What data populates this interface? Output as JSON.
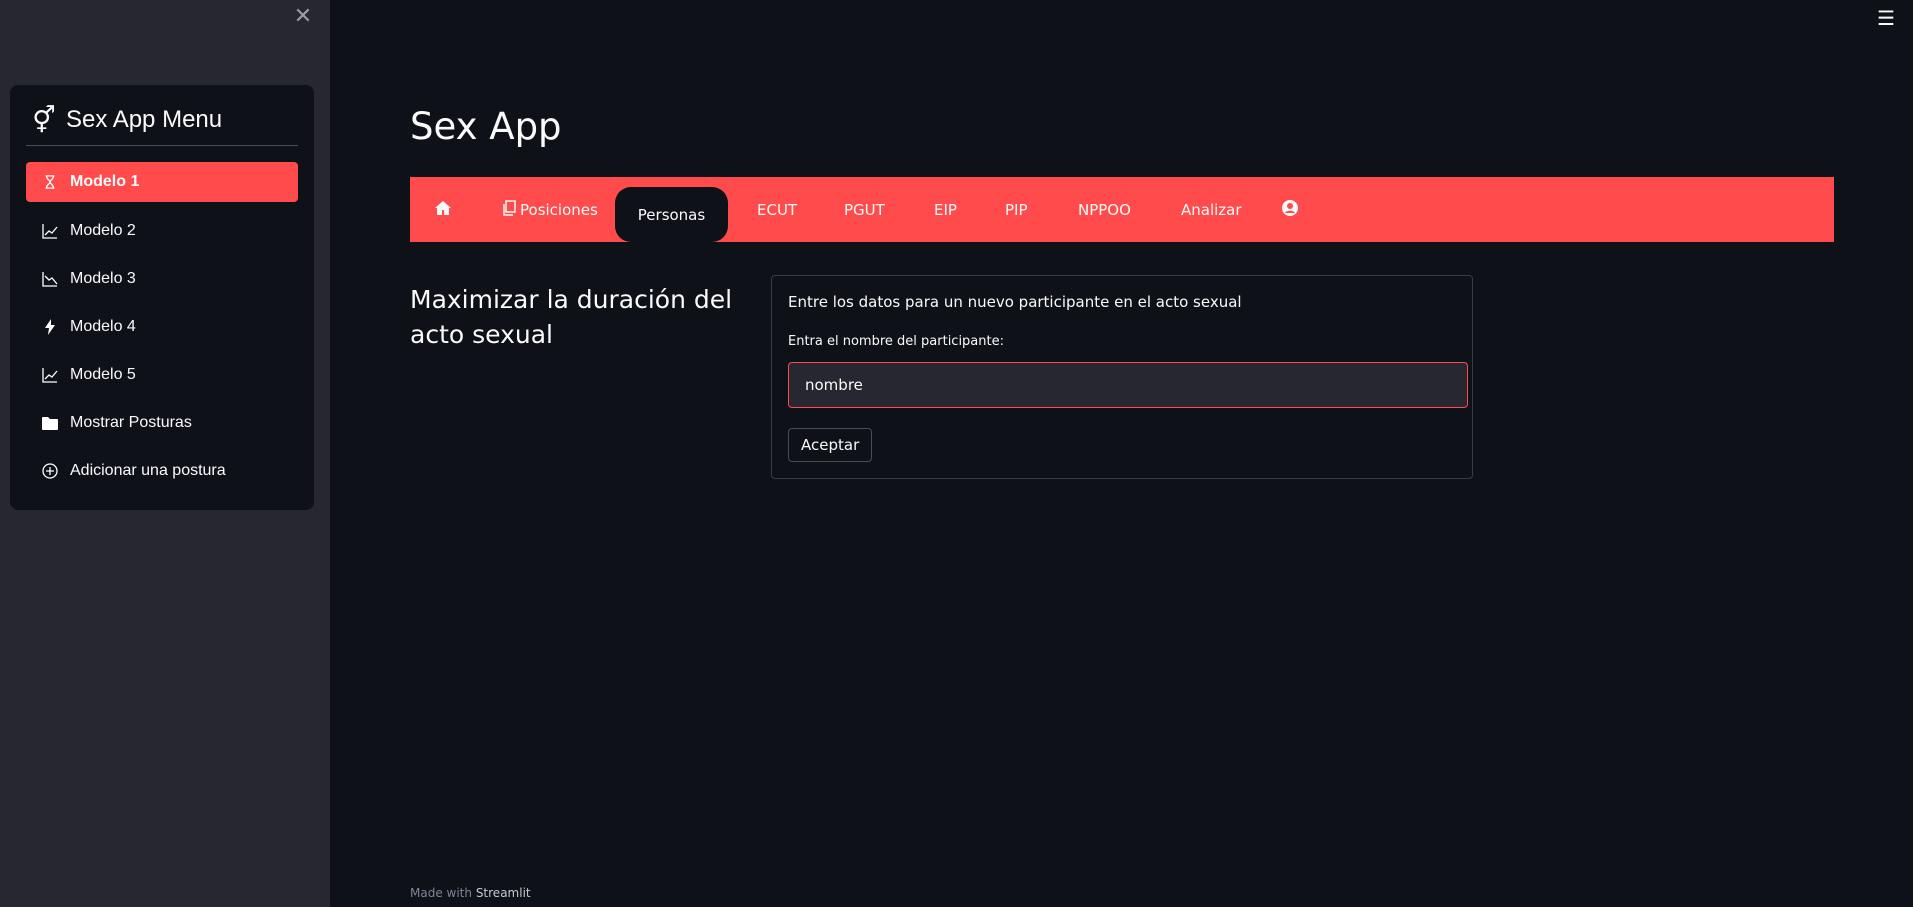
{
  "sidebar": {
    "title": "Sex App Menu",
    "items": [
      {
        "label": "Modelo 1",
        "icon": "hourglass-icon",
        "active": true
      },
      {
        "label": "Modelo 2",
        "icon": "graph-up-icon",
        "active": false
      },
      {
        "label": "Modelo 3",
        "icon": "graph-down-icon",
        "active": false
      },
      {
        "label": "Modelo 4",
        "icon": "lightning-icon",
        "active": false
      },
      {
        "label": "Modelo 5",
        "icon": "graph-up-icon",
        "active": false
      },
      {
        "label": "Mostrar Posturas",
        "icon": "folder-icon",
        "active": false
      },
      {
        "label": "Adicionar una postura",
        "icon": "plus-circle-icon",
        "active": false
      }
    ]
  },
  "main": {
    "title": "Sex App",
    "tabs": [
      {
        "label": "",
        "icon": "home-icon"
      },
      {
        "label": "Posiciones",
        "icon": "copy-icon"
      },
      {
        "label": "Personas",
        "active": true
      },
      {
        "label": "ECUT"
      },
      {
        "label": "PGUT"
      },
      {
        "label": "EIP"
      },
      {
        "label": "PIP"
      },
      {
        "label": "NPPOO"
      },
      {
        "label": "Analizar"
      },
      {
        "label": "",
        "icon": "user-circle-icon"
      }
    ],
    "section_heading": "Maximizar la duración del acto sexual",
    "form": {
      "description": "Entre los datos para un nuevo participante en el acto sexual",
      "input_label": "Entra el nombre del participante:",
      "input_value": "nombre",
      "submit_label": "Aceptar"
    }
  },
  "footer": {
    "prefix": "Made with",
    "brand": "Streamlit"
  },
  "colors": {
    "accent": "#ff4b4b",
    "background": "#0e1117",
    "sidebar": "#262730"
  }
}
